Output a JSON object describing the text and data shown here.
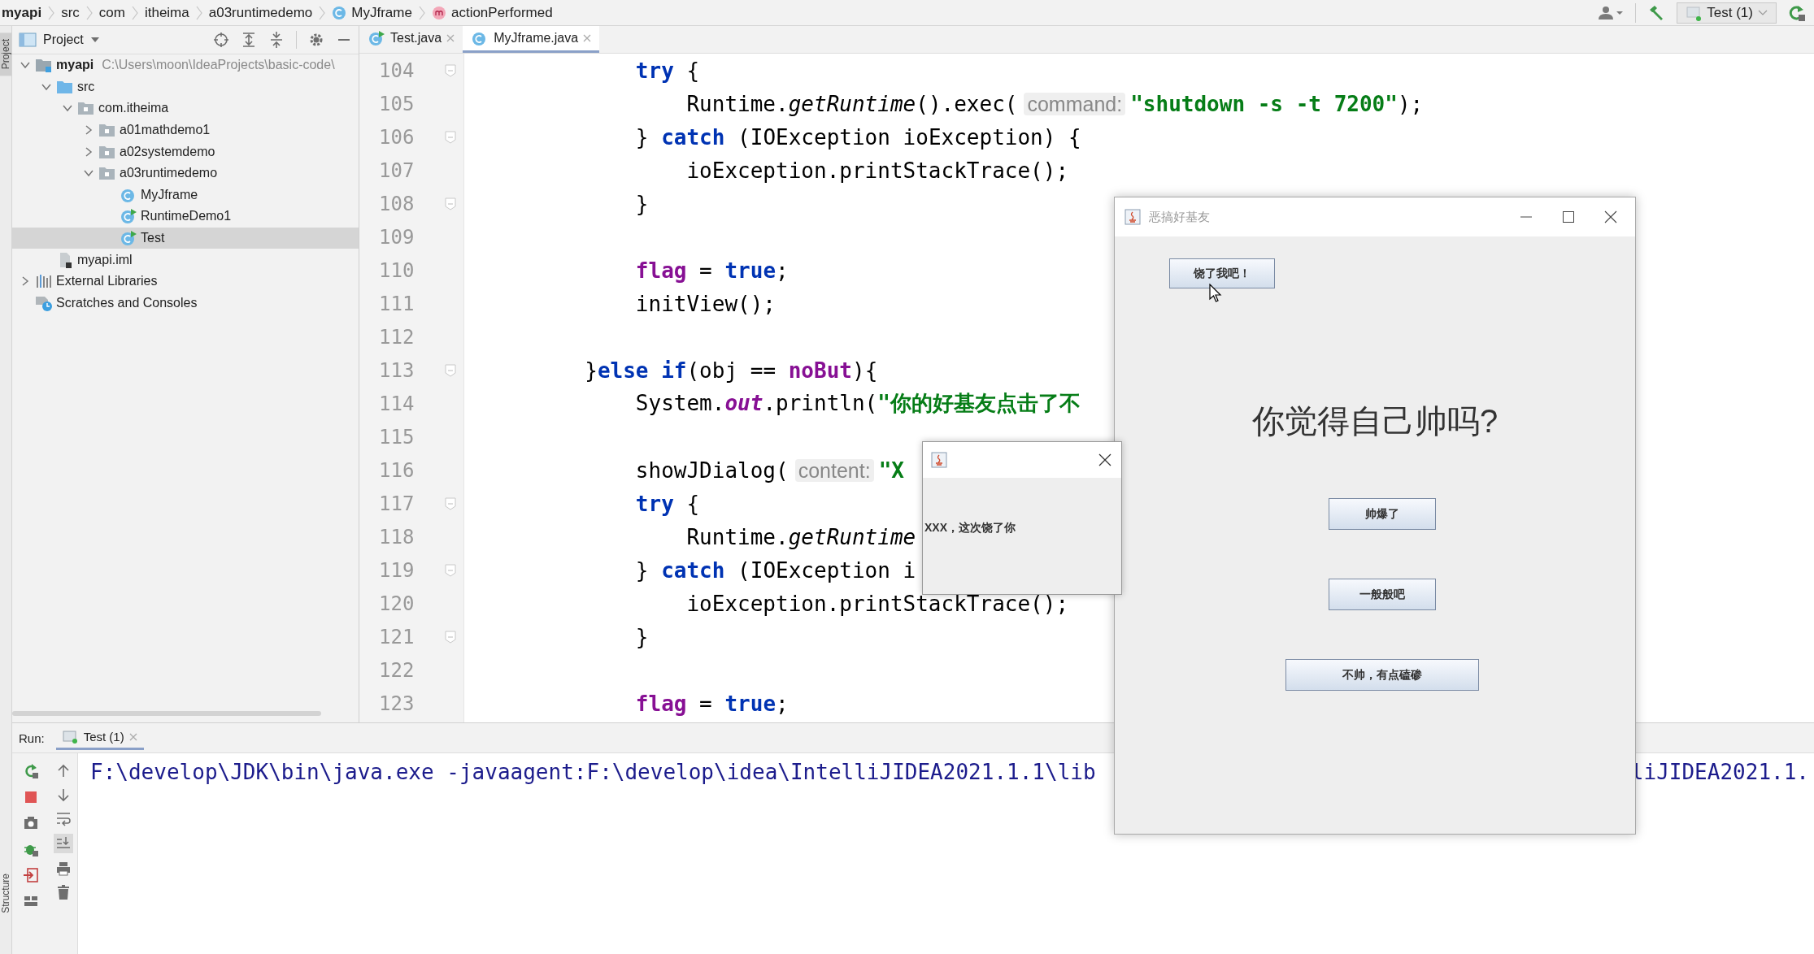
{
  "breadcrumbs": [
    {
      "text": "myapi",
      "kind": "project"
    },
    {
      "text": "src",
      "kind": "plain"
    },
    {
      "text": "com",
      "kind": "plain"
    },
    {
      "text": "itheima",
      "kind": "plain"
    },
    {
      "text": "a03runtimedemo",
      "kind": "plain"
    },
    {
      "text": "MyJframe",
      "kind": "class"
    },
    {
      "text": "actionPerformed",
      "kind": "method"
    }
  ],
  "run_config": {
    "label": "Test (1)"
  },
  "side_strip": {
    "top_tab": "Project",
    "bottom_tab": "Structure"
  },
  "project_panel": {
    "title": "Project",
    "tree": [
      {
        "label": "myapi",
        "path": "C:\\Users\\moon\\IdeaProjects\\basic-code\\",
        "kind": "module",
        "expanded": true,
        "selected": false,
        "children": [
          {
            "label": "src",
            "kind": "source",
            "expanded": true,
            "selected": false,
            "children": [
              {
                "label": "com.itheima",
                "kind": "package",
                "expanded": true,
                "selected": false,
                "children": [
                  {
                    "label": "a01mathdemo1",
                    "kind": "package",
                    "expanded": false,
                    "selected": false
                  },
                  {
                    "label": "a02systemdemo",
                    "kind": "package",
                    "expanded": false,
                    "selected": false
                  },
                  {
                    "label": "a03runtimedemo",
                    "kind": "package",
                    "expanded": true,
                    "selected": false,
                    "children": [
                      {
                        "label": "MyJframe",
                        "kind": "class",
                        "selected": false
                      },
                      {
                        "label": "RuntimeDemo1",
                        "kind": "runnable",
                        "selected": false
                      },
                      {
                        "label": "Test",
                        "kind": "runnable",
                        "selected": true
                      }
                    ]
                  }
                ]
              }
            ]
          },
          {
            "label": "myapi.iml",
            "kind": "file",
            "selected": false
          }
        ]
      },
      {
        "label": "External Libraries",
        "kind": "libraries",
        "expanded": false,
        "selected": false
      },
      {
        "label": "Scratches and Consoles",
        "kind": "scratches",
        "selected": false
      }
    ]
  },
  "editor": {
    "tabs": [
      {
        "label": "Test.java",
        "kind": "runnable",
        "selected": false
      },
      {
        "label": "MyJframe.java",
        "kind": "class",
        "selected": true
      }
    ],
    "lines": [
      {
        "number": "104",
        "fold": true,
        "tokens": [
          {
            "kind": "keyword",
            "text": "            try"
          },
          {
            "kind": "plain",
            "text": " {"
          }
        ]
      },
      {
        "number": "105",
        "fold": false,
        "tokens": [
          {
            "kind": "plain",
            "text": "                Runtime."
          },
          {
            "kind": "method",
            "text": "getRuntime"
          },
          {
            "kind": "plain",
            "text": "().exec("
          },
          {
            "kind": "hint",
            "text": "command:"
          },
          {
            "kind": "string",
            "text": "\"shutdown -s -t 7200\""
          },
          {
            "kind": "plain",
            "text": ");"
          }
        ]
      },
      {
        "number": "106",
        "fold": true,
        "tokens": [
          {
            "kind": "plain",
            "text": "            } "
          },
          {
            "kind": "keyword",
            "text": "catch"
          },
          {
            "kind": "plain",
            "text": " (IOException ioException) {"
          }
        ]
      },
      {
        "number": "107",
        "fold": false,
        "tokens": [
          {
            "kind": "plain",
            "text": "                ioException.printStackTrace();"
          }
        ]
      },
      {
        "number": "108",
        "fold": true,
        "tokens": [
          {
            "kind": "plain",
            "text": "            }"
          }
        ]
      },
      {
        "number": "109",
        "fold": false
      },
      {
        "number": "110",
        "fold": false,
        "tokens": [
          {
            "kind": "field",
            "text": "            flag"
          },
          {
            "kind": "plain",
            "text": " = "
          },
          {
            "kind": "keyword",
            "text": "true"
          },
          {
            "kind": "plain",
            "text": ";"
          }
        ]
      },
      {
        "number": "111",
        "fold": false,
        "tokens": [
          {
            "kind": "plain",
            "text": "            initView();"
          }
        ]
      },
      {
        "number": "112",
        "fold": false
      },
      {
        "number": "113",
        "fold": true,
        "tokens": [
          {
            "kind": "plain",
            "text": "        }"
          },
          {
            "kind": "keyword",
            "text": "else if"
          },
          {
            "kind": "plain",
            "text": "(obj == "
          },
          {
            "kind": "field",
            "text": "noBut"
          },
          {
            "kind": "plain",
            "text": "){"
          }
        ]
      },
      {
        "number": "114",
        "fold": false,
        "tokens": [
          {
            "kind": "plain",
            "text": "            System."
          },
          {
            "kind": "static",
            "text": "out"
          },
          {
            "kind": "plain",
            "text": ".println("
          },
          {
            "kind": "string",
            "text": "\"你的好基友点击了不"
          }
        ]
      },
      {
        "number": "115",
        "fold": false
      },
      {
        "number": "116",
        "fold": false,
        "tokens": [
          {
            "kind": "plain",
            "text": "            showJDialog("
          },
          {
            "kind": "hint",
            "text": "content:"
          },
          {
            "kind": "string",
            "text": "\"X"
          }
        ]
      },
      {
        "number": "117",
        "fold": true,
        "tokens": [
          {
            "kind": "keyword",
            "text": "            try"
          },
          {
            "kind": "plain",
            "text": " {"
          }
        ]
      },
      {
        "number": "118",
        "fold": false,
        "tokens": [
          {
            "kind": "plain",
            "text": "                Runtime."
          },
          {
            "kind": "method",
            "text": "getRuntime"
          }
        ]
      },
      {
        "number": "119",
        "fold": true,
        "tokens": [
          {
            "kind": "plain",
            "text": "            } "
          },
          {
            "kind": "keyword",
            "text": "catch"
          },
          {
            "kind": "plain",
            "text": " (IOException i"
          }
        ]
      },
      {
        "number": "120",
        "fold": false,
        "tokens": [
          {
            "kind": "plain",
            "text": "                ioException.printStackTrace();"
          }
        ]
      },
      {
        "number": "121",
        "fold": true,
        "tokens": [
          {
            "kind": "plain",
            "text": "            }"
          }
        ]
      },
      {
        "number": "122",
        "fold": false
      },
      {
        "number": "123",
        "fold": false,
        "tokens": [
          {
            "kind": "field",
            "text": "            flag"
          },
          {
            "kind": "plain",
            "text": " = "
          },
          {
            "kind": "keyword",
            "text": "true"
          },
          {
            "kind": "plain",
            "text": ";"
          }
        ]
      }
    ]
  },
  "run_panel": {
    "label": "Run:",
    "tab": {
      "label": "Test (1)",
      "selected": true
    },
    "console_line": "F:\\develop\\JDK\\bin\\java.exe -javaagent:F:\\develop\\idea\\IntelliJIDEA2021.1.1\\lib",
    "console_line_tail": "liJIDEA2021.1."
  },
  "app_window": {
    "title": "恶搞好基友",
    "question": "你觉得自己帅吗?",
    "buttons": [
      {
        "label": "饶了我吧！",
        "kind": "top"
      },
      {
        "label": "帅爆了",
        "kind": "answer_1"
      },
      {
        "label": "一般般吧",
        "kind": "answer_2"
      },
      {
        "label": "不帅，有点磕碜",
        "kind": "answer_3"
      }
    ]
  },
  "dialog": {
    "message": "XXX，这次饶了你"
  }
}
